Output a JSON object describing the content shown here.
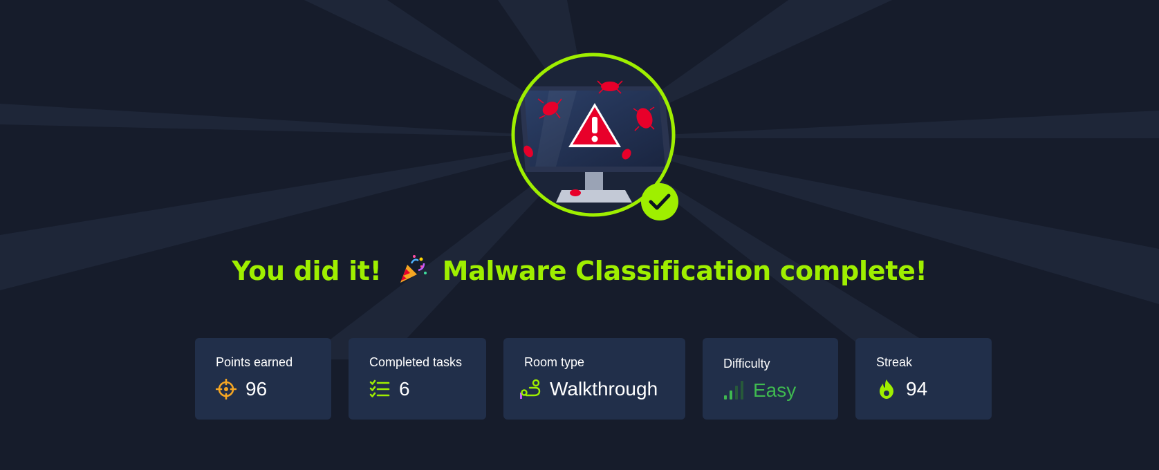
{
  "heading": {
    "before": "You did it!",
    "after": "Malware Classification complete!"
  },
  "stats": [
    {
      "label": "Points earned",
      "value": "96",
      "icon": "target-icon"
    },
    {
      "label": "Completed tasks",
      "value": "6",
      "icon": "checklist-icon"
    },
    {
      "label": "Room type",
      "value": "Walkthrough",
      "icon": "route-icon"
    },
    {
      "label": "Difficulty",
      "value": "Easy",
      "icon": "signal-bars-icon"
    },
    {
      "label": "Streak",
      "value": "94",
      "icon": "flame-icon"
    }
  ],
  "colors": {
    "background": "#161c2b",
    "accent": "#9fef00",
    "card": "#212f4a",
    "alert": "#e8002a",
    "easy": "#3fb950",
    "points": "#f5a623"
  }
}
